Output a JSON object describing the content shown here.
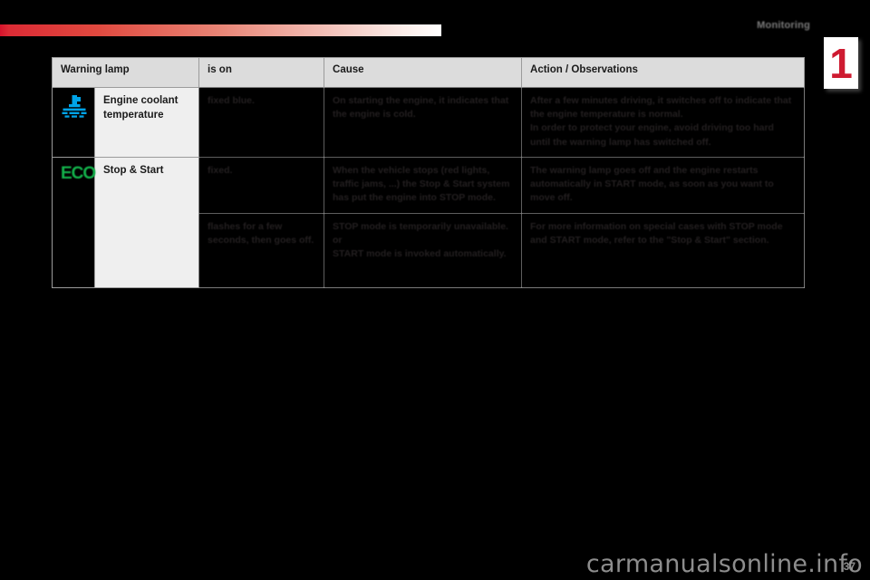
{
  "header": {
    "section_title": "Monitoring",
    "chapter_number": "1",
    "accent_color": "#ce1b31"
  },
  "table": {
    "columns": [
      {
        "key": "icon",
        "label": ""
      },
      {
        "key": "warning_lamp",
        "label": "Warning lamp"
      },
      {
        "key": "is_on",
        "label": "is on"
      },
      {
        "key": "cause",
        "label": "Cause"
      },
      {
        "key": "action",
        "label": "Action / Observations"
      }
    ],
    "rows": [
      {
        "icon_name": "engine-coolant-temperature-icon",
        "icon_color": "#00a3e8",
        "warning_lamp": "Engine coolant temperature",
        "is_on": "fixed blue.",
        "cause": "On starting the engine, it indicates that the engine is cold.",
        "action_lines": [
          "After a few minutes driving, it switches off to indicate that the engine temperature is normal.",
          "In order to protect your engine, avoid driving too hard until the warning lamp has switched off."
        ]
      },
      {
        "icon_name": "eco-stop-start-icon",
        "icon_label": "ECO",
        "icon_color": "#13b24b",
        "warning_lamp": "Stop & Start",
        "is_on": "fixed.",
        "cause": "When the vehicle stops (red lights, traffic jams, ...) the Stop & Start system has put the engine into STOP mode.",
        "action_lines": [
          "The warning lamp goes off and the engine restarts automatically in START mode, as soon as you want to move off."
        ]
      },
      {
        "icon_name": "",
        "warning_lamp": "",
        "is_on": "flashes for a few seconds, then goes off.",
        "cause_lines": [
          "STOP mode is temporarily unavailable.",
          "or",
          "START mode is invoked automatically."
        ],
        "action_lines": [
          "For more information on special cases with STOP mode and START mode, refer to the \"Stop & Start\" section."
        ]
      }
    ]
  },
  "footer": {
    "page_number": "37",
    "watermark": "carmanualsonline.info"
  }
}
